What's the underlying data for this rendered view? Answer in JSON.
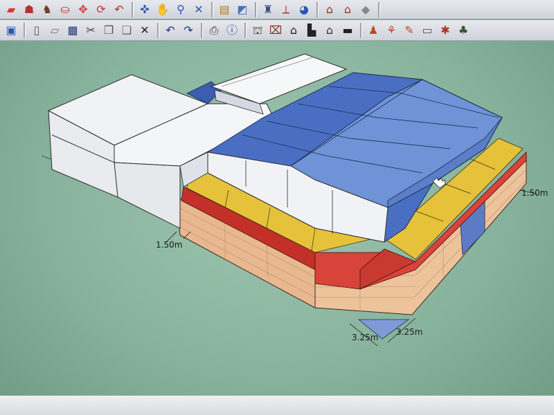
{
  "toolbar_row1": [
    {
      "name": "eraser-icon",
      "glyph": "▰",
      "color": "#d23a3a"
    },
    {
      "name": "person-icon",
      "glyph": "☗",
      "color": "#b5332b"
    },
    {
      "name": "walk-icon",
      "glyph": "♞",
      "color": "#6b3a1a"
    },
    {
      "name": "paint-bucket-icon",
      "glyph": "⛀",
      "color": "#b83b2a"
    },
    {
      "name": "move-icon",
      "glyph": "✥",
      "color": "#d13a3a"
    },
    {
      "name": "rotate-icon",
      "glyph": "⟳",
      "color": "#c0392b"
    },
    {
      "name": "follow-me-icon",
      "glyph": "↶",
      "color": "#b03030"
    },
    {
      "name": "orbit-icon",
      "glyph": "✜",
      "color": "#2a58b0"
    },
    {
      "name": "pan-hand-icon",
      "glyph": "✋",
      "color": "#555555"
    },
    {
      "name": "zoom-icon",
      "glyph": "⚲",
      "color": "#2a58b0"
    },
    {
      "name": "zoom-extents-icon",
      "glyph": "✕",
      "color": "#2a58b0"
    },
    {
      "name": "section-plane-icon",
      "glyph": "▤",
      "color": "#b07a20"
    },
    {
      "name": "component-icon",
      "glyph": "◩",
      "color": "#4a6fb5"
    },
    {
      "name": "figure-icon",
      "glyph": "♜",
      "color": "#3a4a7a"
    },
    {
      "name": "axis-icon",
      "glyph": "⟂",
      "color": "#b03030"
    },
    {
      "name": "globe-icon",
      "glyph": "◕",
      "color": "#2a58b0"
    },
    {
      "name": "house-icon",
      "glyph": "⌂",
      "color": "#8a3a1a"
    },
    {
      "name": "roof-icon",
      "glyph": "⌂",
      "color": "#b03020"
    },
    {
      "name": "small-box-icon",
      "glyph": "◆",
      "color": "#888888"
    }
  ],
  "toolbar_row2": [
    {
      "name": "box-icon",
      "glyph": "▣",
      "color": "#2a58b0"
    },
    {
      "name": "new-file-icon",
      "glyph": "▯",
      "color": "#555555"
    },
    {
      "name": "open-folder-icon",
      "glyph": "▱",
      "color": "#777777"
    },
    {
      "name": "save-icon",
      "glyph": "▩",
      "color": "#2a3e7a"
    },
    {
      "name": "cut-icon",
      "glyph": "✂",
      "color": "#444444"
    },
    {
      "name": "copy-icon",
      "glyph": "❐",
      "color": "#555555"
    },
    {
      "name": "paste-icon",
      "glyph": "❑",
      "color": "#666666"
    },
    {
      "name": "delete-icon",
      "glyph": "✕",
      "color": "#222222"
    },
    {
      "name": "undo-icon",
      "glyph": "↶",
      "color": "#1a3a7a"
    },
    {
      "name": "redo-icon",
      "glyph": "↷",
      "color": "#1a3a7a"
    },
    {
      "name": "print-icon",
      "glyph": "⎙",
      "color": "#333333"
    },
    {
      "name": "info-icon",
      "glyph": "ⓘ",
      "color": "#1a55c0"
    },
    {
      "name": "iso-view-icon",
      "glyph": "⛫",
      "color": "#333333"
    },
    {
      "name": "door-icon",
      "glyph": "⌧",
      "color": "#8a2a1a"
    },
    {
      "name": "front-view-icon",
      "glyph": "⌂",
      "color": "#222222"
    },
    {
      "name": "top-view-icon",
      "glyph": "▙",
      "color": "#222222"
    },
    {
      "name": "side-view-icon",
      "glyph": "⌂",
      "color": "#333333"
    },
    {
      "name": "back-view-icon",
      "glyph": "▬",
      "color": "#222222"
    },
    {
      "name": "walk-person-icon",
      "glyph": "♟",
      "color": "#c04a20"
    },
    {
      "name": "look-around-icon",
      "glyph": "⚘",
      "color": "#c04a20"
    },
    {
      "name": "pencil-icon",
      "glyph": "✎",
      "color": "#c04a20"
    },
    {
      "name": "text-icon",
      "glyph": "▭",
      "color": "#555555"
    },
    {
      "name": "star-icon",
      "glyph": "✱",
      "color": "#b03030"
    },
    {
      "name": "tree-icon",
      "glyph": "♣",
      "color": "#335533"
    }
  ],
  "dimensions": {
    "left": "1.50m",
    "right": "1.50m",
    "bottom_left": "3.25m",
    "bottom_right": "3.25m"
  },
  "colors": {
    "ground": "#86b29b",
    "wall_white": "#eef0f4",
    "roof_blue_dark": "#3e63b8",
    "roof_blue_light": "#6f93d6",
    "parapet_yellow": "#e6c23a",
    "band_red": "#c3302a",
    "brick": "#e8b890"
  }
}
